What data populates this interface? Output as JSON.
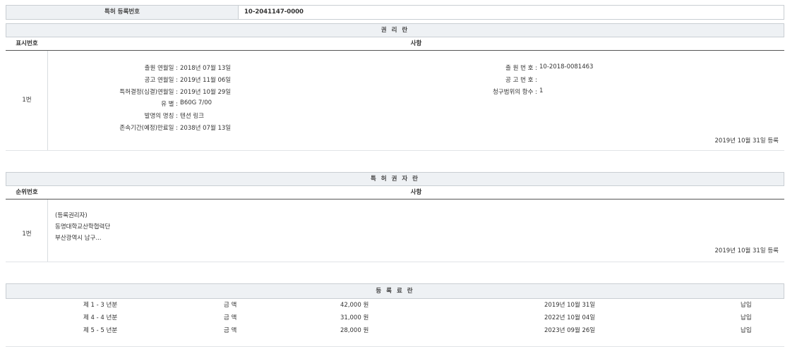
{
  "top": {
    "label": "특허 등록번호",
    "value": "10-2041147-0000"
  },
  "rights": {
    "title": "권 리 란",
    "col_num": "표시번호",
    "col_desc": "사항",
    "row_num": "1번",
    "left_fields": [
      {
        "label": "출원 연월일 :",
        "value": "2018년 07월 13일"
      },
      {
        "label": "공고 연월일 :",
        "value": "2019년 11월 06일"
      },
      {
        "label": "특허결정(심결)연월일 :",
        "value": "2019년 10월 29일"
      },
      {
        "label": "유 별 :",
        "value": "B60G 7/00"
      },
      {
        "label": "발명의 명칭 :",
        "value": "텐션 링크"
      },
      {
        "label": "존속기간(예정)만료일 :",
        "value": "2038년 07월 13일"
      }
    ],
    "right_fields": [
      {
        "label": "출 원 번 호 :",
        "value": "10-2018-0081463"
      },
      {
        "label": "공 고 번 호 :",
        "value": ""
      },
      {
        "label": "청구범위의 항수 :",
        "value": "1"
      }
    ],
    "reg_date": "2019년 10월 31일 등록"
  },
  "holders": {
    "title": "특 허 권 자 란",
    "col_num": "순위번호",
    "col_desc": "사항",
    "row_num": "1번",
    "lines": [
      "(등록권리자)",
      "동명대학교산학협력단",
      "부산광역시 남구..."
    ],
    "reg_date": "2019년 10월 31일 등록"
  },
  "fees": {
    "title": "등 록 료 란",
    "rows": [
      {
        "period": "제 1 - 3 년분",
        "label": "금 액",
        "amount": "42,000 원",
        "date": "2019년 10월 31일",
        "status": "납입"
      },
      {
        "period": "제 4 - 4 년분",
        "label": "금 액",
        "amount": "31,000 원",
        "date": "2022년 10월 04일",
        "status": "납입"
      },
      {
        "period": "제 5 - 5 년분",
        "label": "금 액",
        "amount": "28,000 원",
        "date": "2023년 09월 26일",
        "status": "납입"
      }
    ]
  }
}
